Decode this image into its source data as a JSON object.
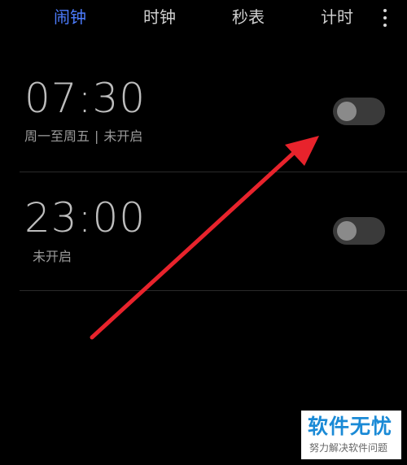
{
  "tabs": [
    {
      "label": "闹钟",
      "active": true
    },
    {
      "label": "时钟",
      "active": false
    },
    {
      "label": "秒表",
      "active": false
    },
    {
      "label": "计时",
      "active": false
    }
  ],
  "colors": {
    "accent": "#4d7dff",
    "background": "#000000",
    "toggle_off": "#3a3a3a",
    "arrow": "#e8232c"
  },
  "icons": {
    "more": "more-vertical-icon"
  },
  "alarms": [
    {
      "time": "07:30",
      "repeat": "周一至周五",
      "separator": "|",
      "status": "未开启",
      "enabled": false
    },
    {
      "time": "23:00",
      "status": "未开启",
      "enabled": false
    }
  ],
  "watermark": {
    "title": "软件无忧",
    "subtitle": "努力解决软件问题"
  }
}
